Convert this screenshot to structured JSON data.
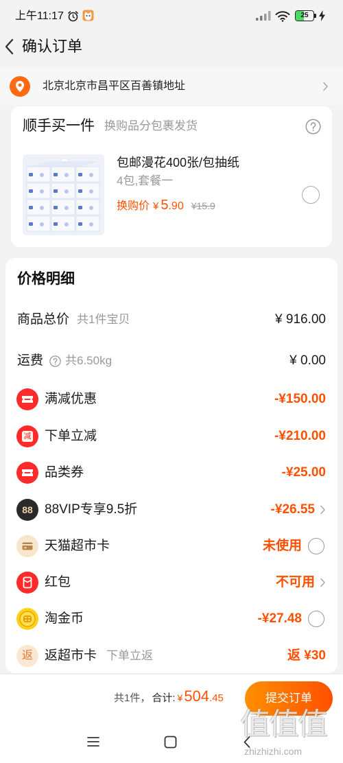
{
  "status_bar": {
    "time": "上午11:17",
    "battery": "25"
  },
  "header": {
    "title": "确认订单",
    "back_icon": "back-icon"
  },
  "address": {
    "icon": "location-pin-icon",
    "text": "北京北京市昌平区百善镇地址"
  },
  "add_on": {
    "title": "顺手买一件",
    "subtitle": "换购品分包裹发货",
    "help_icon": "help-icon",
    "product": {
      "name": "包邮漫花400张/包抽纸",
      "spec": "4包,套餐一",
      "price_label": "换购价",
      "currency": "¥",
      "price_int": "5",
      "price_dec": ".90",
      "original_price": "¥15.9",
      "selected": false
    }
  },
  "price_detail": {
    "title": "价格明细",
    "rows": [
      {
        "label": "商品总价",
        "sub": "共1件宝贝",
        "value": "¥ 916.00"
      },
      {
        "label": "运费",
        "sub": "共6.50kg",
        "value": "¥ 0.00",
        "help_icon": "help-icon"
      },
      {
        "icon": "coupon-icon",
        "label": "满减优惠",
        "value": "-¥150.00"
      },
      {
        "icon": "instant-discount-icon",
        "icon_text": "减",
        "label": "下单立减",
        "value": "-¥210.00"
      },
      {
        "icon": "category-coupon-icon",
        "label": "品类券",
        "value": "-¥25.00"
      },
      {
        "icon": "vip-88-icon",
        "icon_text": "88",
        "label": "88VIP专享9.5折",
        "value": "-¥26.55",
        "action": "chevron-right-icon"
      },
      {
        "icon": "supermarket-card-icon",
        "label": "天猫超市卡",
        "value": "未使用",
        "action": "radio",
        "selected": false
      },
      {
        "icon": "red-packet-icon",
        "label": "红包",
        "value": "不可用",
        "action": "chevron-right-icon"
      },
      {
        "icon": "gold-coin-icon",
        "label": "淘金币",
        "value": "-¥27.48",
        "action": "radio",
        "selected": false
      },
      {
        "icon": "rebate-icon",
        "icon_text": "返",
        "label": "返超市卡",
        "sub": "下单立返",
        "value": "返 ¥30"
      }
    ]
  },
  "footer": {
    "count": "共1件，",
    "total_label": "合计:",
    "currency": "¥",
    "total_int": "504",
    "total_dec": ".45",
    "submit_label": "提交订单"
  },
  "system_nav": {
    "items": [
      "menu-icon",
      "home-icon",
      "back-nav-icon"
    ]
  },
  "watermark": {
    "logo": "值值值",
    "url": "zhizhizhi.com"
  },
  "colors": {
    "accent": "#ff5000",
    "background": "#f3f3f3",
    "card": "#ffffff",
    "muted": "#999999",
    "button_gradient": [
      "#ff9000",
      "#ff5000"
    ],
    "battery": "#4cd964",
    "location_pin": "#ff6a12"
  }
}
